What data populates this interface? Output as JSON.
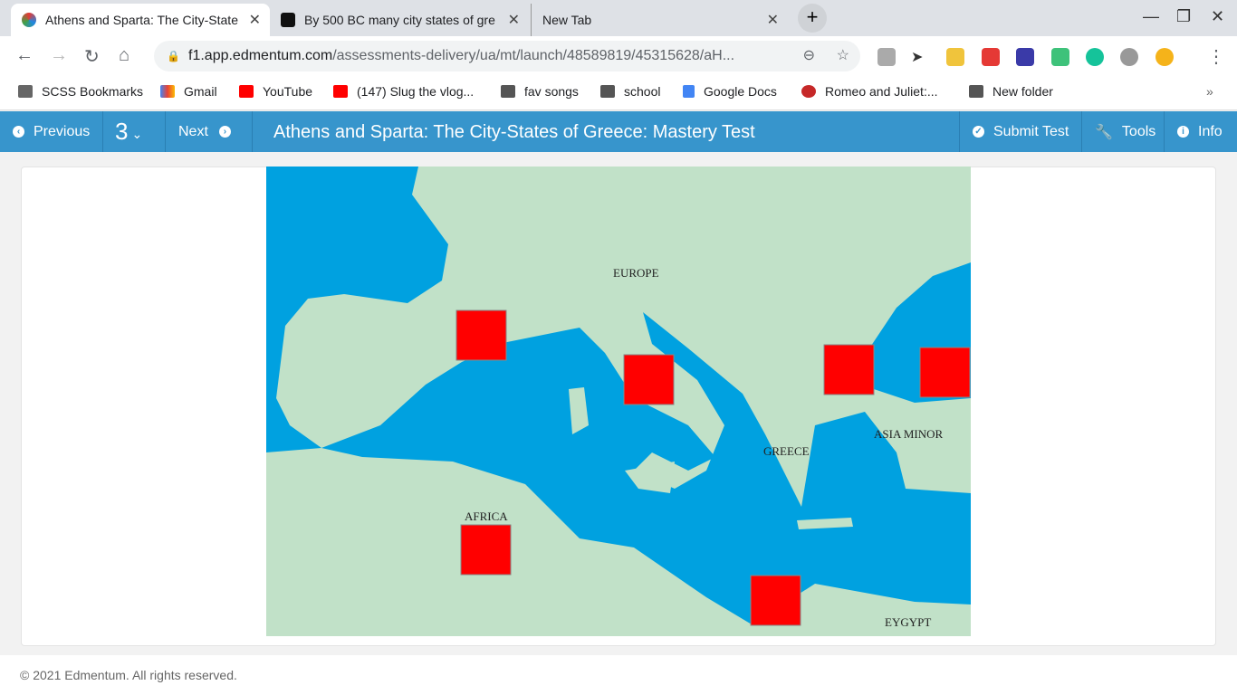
{
  "browser": {
    "tabs": [
      {
        "title": "Athens and Sparta: The City-State",
        "active": true
      },
      {
        "title": "By 500 BC many city states of gre",
        "active": false
      },
      {
        "title": "New Tab",
        "active": false
      }
    ],
    "url_host": "f1.app.edmentum.com",
    "url_path": "/assessments-delivery/ua/mt/launch/48589819/45315628/aH...",
    "bookmarks": [
      "SCSS Bookmarks",
      "Gmail",
      "YouTube",
      "(147) Slug the vlog...",
      "fav songs",
      "school",
      "Google Docs",
      "Romeo and Juliet:...",
      "New folder"
    ],
    "more": "»"
  },
  "app": {
    "previous": "Previous",
    "question_number": "3",
    "next": "Next",
    "title": "Athens and Sparta: The City-States of Greece: Mastery Test",
    "submit": "Submit Test",
    "tools": "Tools",
    "info": "Info"
  },
  "map": {
    "labels": {
      "europe": "EUROPE",
      "asia_minor": "ASIA MINOR",
      "greece": "GREECE",
      "africa": "AFRICA",
      "egypt": "EYGYPT"
    },
    "land_color": "#c1e1c8",
    "sea_color": "#00a1e0",
    "marker_color": "#ff0000",
    "drop_targets": 6
  },
  "footer": "© 2021 Edmentum. All rights reserved."
}
